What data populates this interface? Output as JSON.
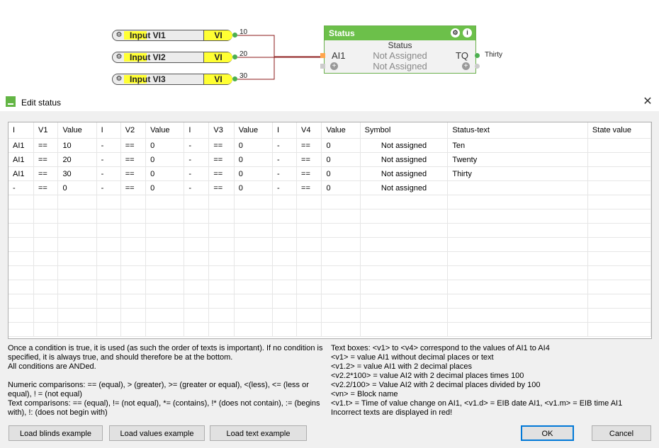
{
  "canvas": {
    "vi_blocks": [
      {
        "name": "Input VI1",
        "tag": "VI",
        "value": "10"
      },
      {
        "name": "Input VI2",
        "tag": "VI",
        "value": "20"
      },
      {
        "name": "Input VI3",
        "tag": "VI",
        "value": "30"
      }
    ],
    "status_node": {
      "title": "Status",
      "subtitle": "Status",
      "in_label": "AI1",
      "in_value": "Not Assigned",
      "add_value": "Not Assigned",
      "out_label": "TQ",
      "out_value": "Thirty"
    }
  },
  "dialog": {
    "title": "Edit status",
    "headers": [
      "I",
      "V1",
      "Value",
      "I",
      "V2",
      "Value",
      "I",
      "V3",
      "Value",
      "I",
      "V4",
      "Value",
      "Symbol",
      "Status-text",
      "State value"
    ],
    "rows": [
      [
        "AI1",
        "==",
        "10",
        "-",
        "==",
        "0",
        "-",
        "==",
        "0",
        "-",
        "==",
        "0",
        "Not assigned",
        "Ten",
        ""
      ],
      [
        "AI1",
        "==",
        "20",
        "-",
        "==",
        "0",
        "-",
        "==",
        "0",
        "-",
        "==",
        "0",
        "Not assigned",
        "Twenty",
        ""
      ],
      [
        "AI1",
        "==",
        "30",
        "-",
        "==",
        "0",
        "-",
        "==",
        "0",
        "-",
        "==",
        "0",
        "Not assigned",
        "Thirty",
        ""
      ],
      [
        "-",
        "==",
        "0",
        "-",
        "==",
        "0",
        "-",
        "==",
        "0",
        "-",
        "==",
        "0",
        "Not assigned",
        "",
        ""
      ]
    ],
    "help_left": [
      "Once a condition is true, it is used (as such the order of texts is important). If no condition is specified, it is always true, and should therefore be at the bottom.",
      "All conditions are ANDed.",
      "",
      "Numeric comparisons: == (equal), > (greater), >= (greater or equal), <(less), <= (less or equal), ! = (not equal)",
      "Text comparisons: == (equal), != (not equal), *= (contains), !* (does not contain), := (begins with), !: (does not begin with)"
    ],
    "help_right": [
      "Text boxes: <v1> to <v4> correspond to the values of AI1 to AI4",
      "<v1> = value AI1 without decimal places or text",
      "<v1.2> = value AI1 with 2 decimal places",
      "<v2.2*100> = value AI2 with 2 decimal places times 100",
      "<v2.2/100> = Value AI2 with 2 decimal places divided by 100",
      "<vn> = Block name",
      "<v1.t> = Time of value change on AI1, <v1.d> = EIB date AI1, <v1.m> = EIB time AI1",
      "Incorrect texts are displayed in red!"
    ],
    "buttons": {
      "load_blinds": "Load blinds example",
      "load_values": "Load values example",
      "load_text": "Load text example",
      "ok": "OK",
      "cancel": "Cancel"
    }
  }
}
